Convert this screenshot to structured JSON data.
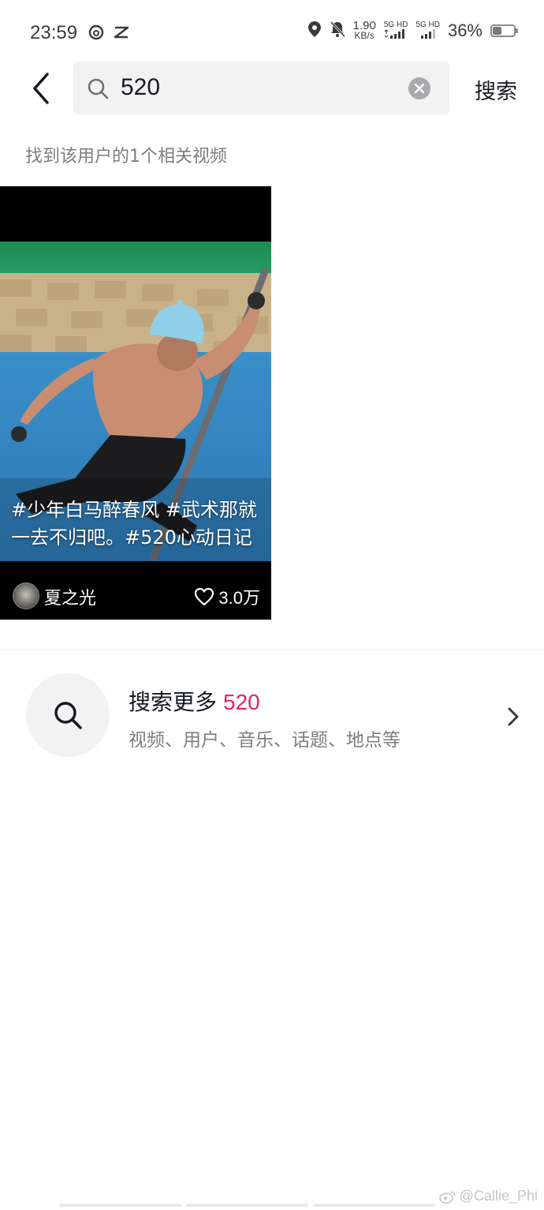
{
  "status_bar": {
    "time": "23:59",
    "net_speed_value": "1.90",
    "net_speed_unit": "KB/s",
    "sim1_label": "5G HD",
    "sim2_label": "5G HD",
    "battery_percent": "36%",
    "battery_level": 0.36,
    "icons": [
      "netease-music-icon",
      "capcut-icon",
      "location-icon",
      "bell-muted-icon",
      "signal-icon",
      "battery-icon"
    ]
  },
  "header": {
    "back_icon": "chevron-left-icon",
    "search_value": "520",
    "search_button_label": "搜索"
  },
  "results": {
    "count_text": "找到该用户的1个相关视频"
  },
  "video": {
    "caption": "#少年白马醉春风 #武术那就一去不归吧。#520心动日记",
    "author": "夏之光",
    "likes": "3.0万"
  },
  "search_more": {
    "title_prefix": "搜索更多",
    "keyword": "520",
    "subtitle": "视频、用户、音乐、话题、地点等"
  },
  "watermark": "@Callie_Phi",
  "colors": {
    "accent": "#e3265d",
    "search_bg": "#f2f2f3",
    "secondary_text": "#7d7e82"
  }
}
